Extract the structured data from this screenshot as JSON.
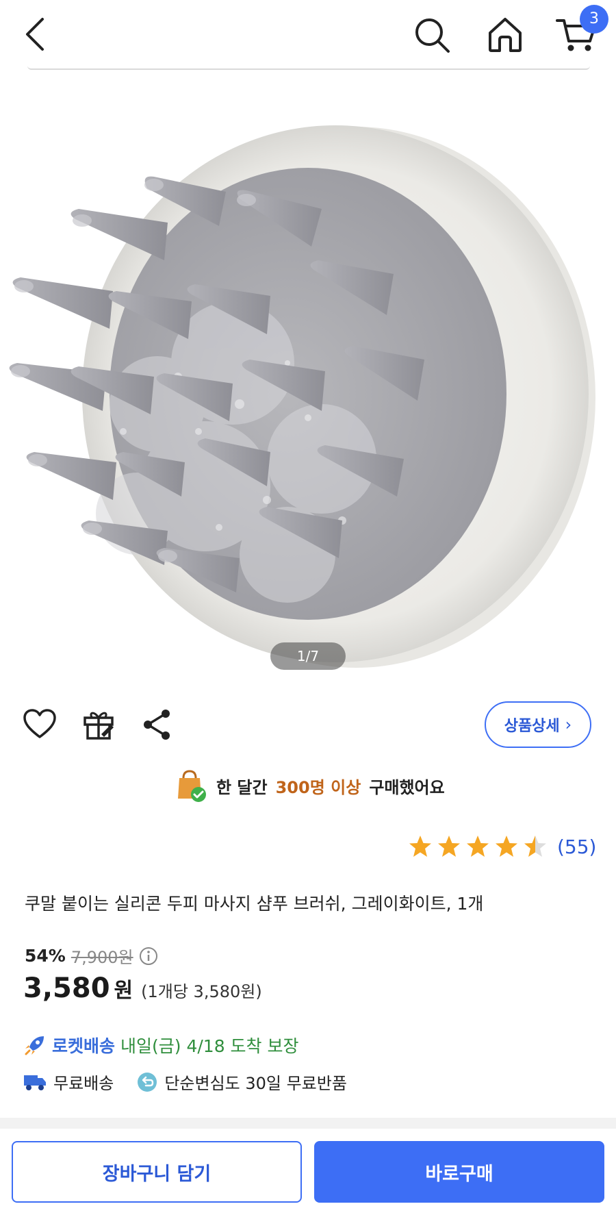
{
  "header": {
    "back_icon": "chevron-left-icon",
    "search_icon": "search-icon",
    "home_icon": "home-icon",
    "cart_icon": "cart-icon",
    "cart_count": "3",
    "accent": "#3d6ef5"
  },
  "gallery": {
    "counter": "1/7"
  },
  "actions": {
    "wishlist_icon": "heart-icon",
    "gift_icon": "gift-icon",
    "share_icon": "share-icon",
    "detail_label": "상품상세",
    "detail_chevron": "›"
  },
  "social_proof": {
    "prefix": "한 달간",
    "highlight": "300명 이상",
    "suffix": "구매했어요",
    "highlight_color": "#c0641a"
  },
  "rating": {
    "stars": 4.5,
    "review_count": "(55)"
  },
  "product": {
    "title": "쿠말 붙이는 실리콘 두피 마사지 샴푸 브러쉬, 그레이화이트, 1개",
    "discount": "54%",
    "original_price": "7,900원",
    "price": "3,580",
    "currency": "원",
    "unit_price": "(1개당 3,580원)"
  },
  "delivery": {
    "rocket_label": "로켓배송",
    "arrival": "내일(금) 4/18 도착 보장",
    "free_shipping": "무료배송",
    "free_return": "단순변심도 30일 무료반품"
  },
  "bottom": {
    "cart_button": "장바구니 담기",
    "buy_button": "바로구매"
  }
}
